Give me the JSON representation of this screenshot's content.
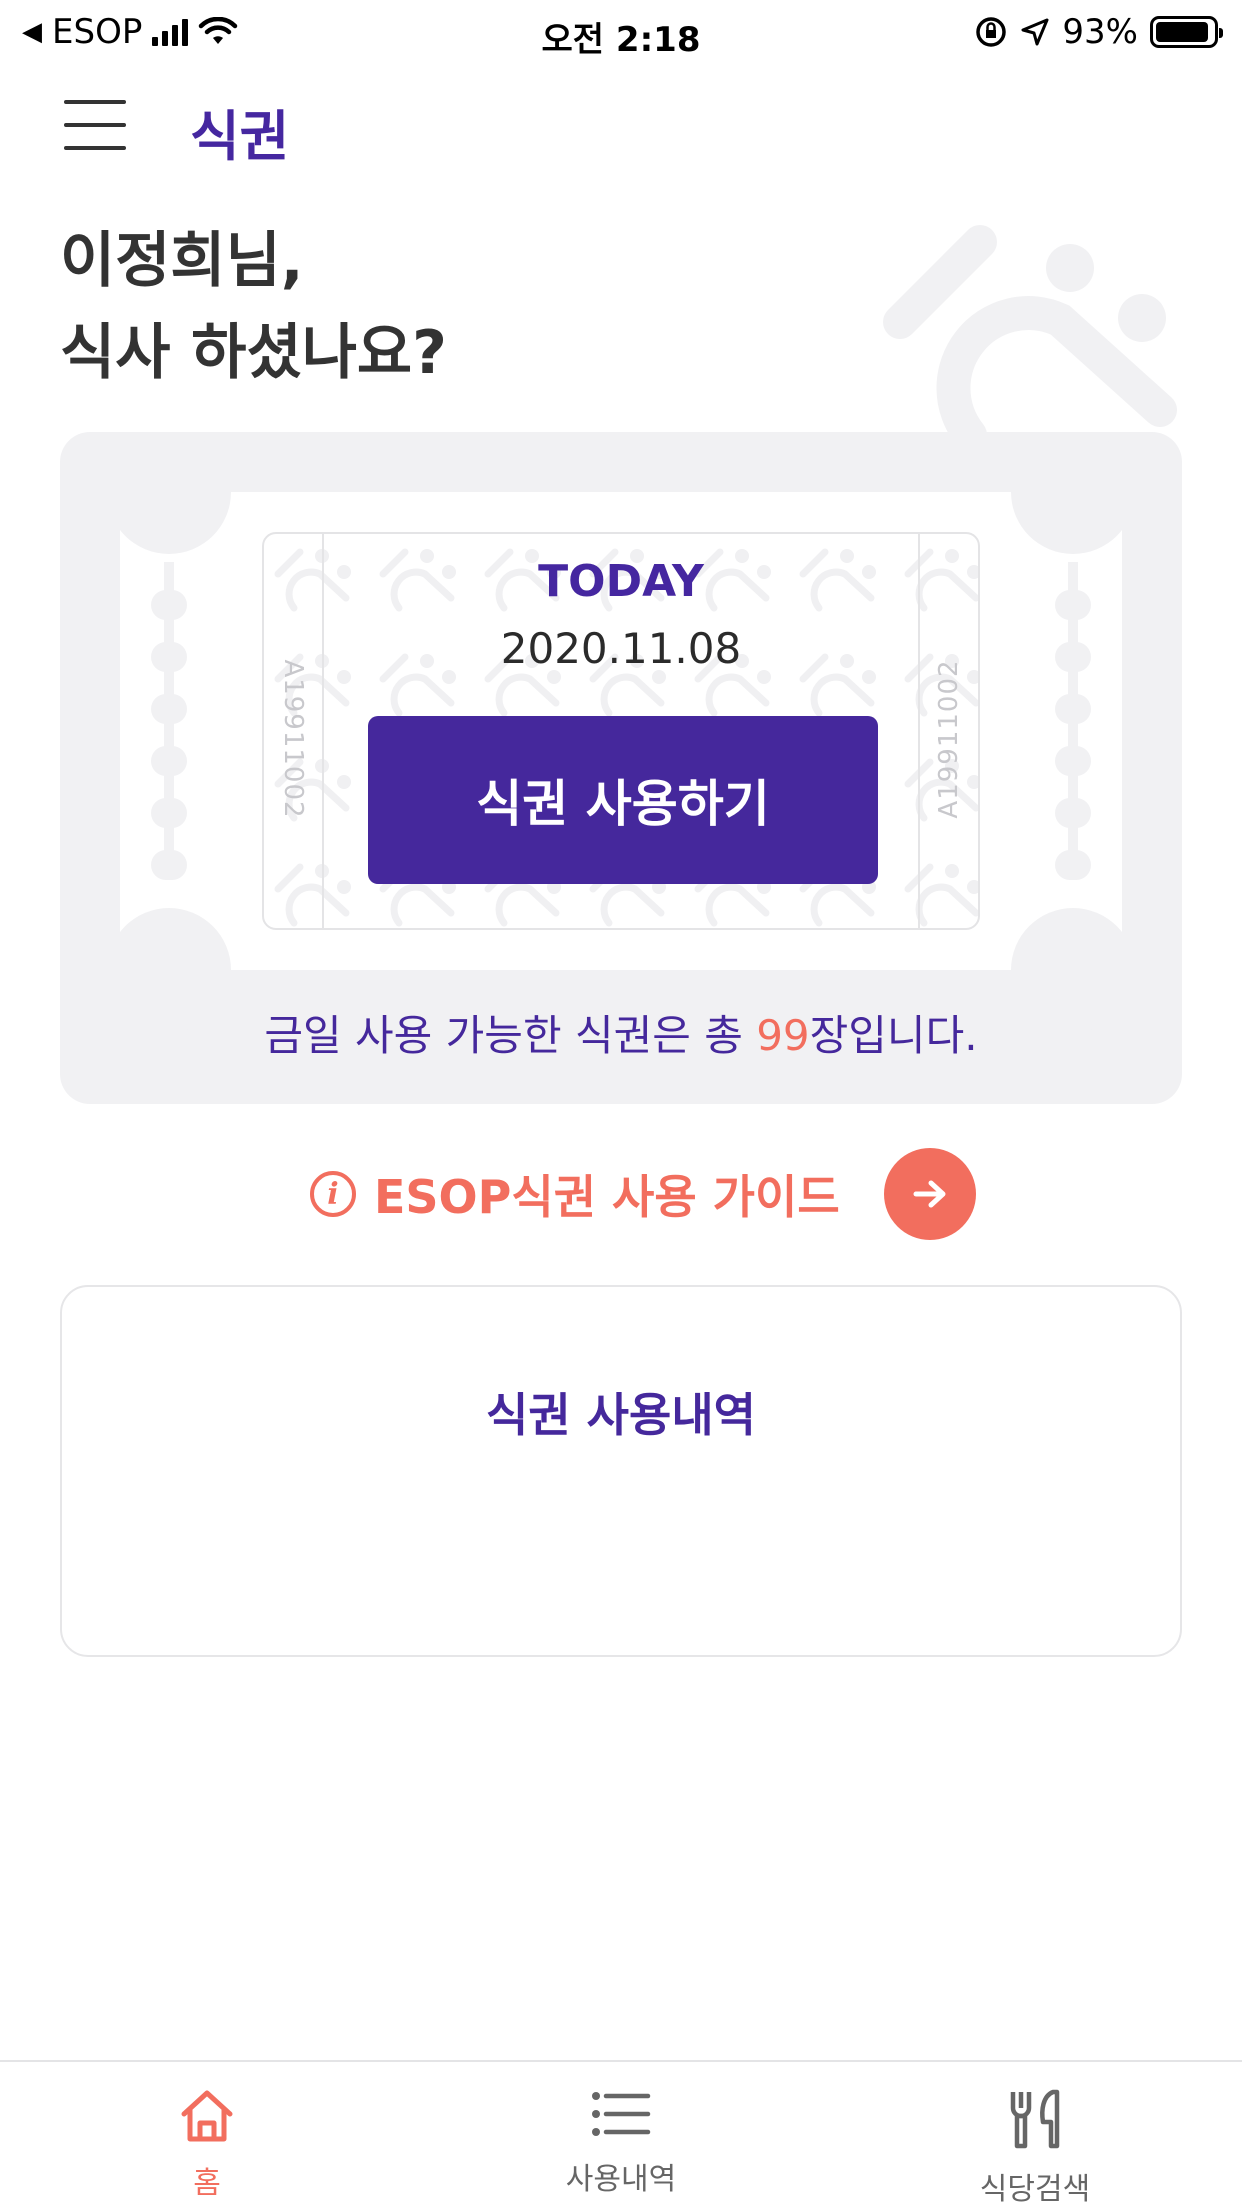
{
  "status_bar": {
    "back_app": "ESOP",
    "time": "오전 2:18",
    "battery": "93%"
  },
  "header": {
    "title": "식권",
    "menu_icon": "hamburger-icon"
  },
  "greeting": {
    "line1": "이정희님,",
    "line2": "식사 하셨나요?"
  },
  "ticket": {
    "today_label": "TODAY",
    "date": "2020.11.08",
    "use_button_label": "식권 사용하기",
    "serial_left": "A19911002",
    "serial_right": "A19911002",
    "available_prefix": "금일 사용 가능한 식권은 총 ",
    "available_count": "99",
    "available_suffix": "장입니다."
  },
  "guide": {
    "label": "ESOP식권 사용 가이드",
    "info_icon": "info-icon",
    "arrow_icon": "arrow-right-icon"
  },
  "history": {
    "title": "식권 사용내역"
  },
  "tabbar": {
    "tabs": [
      {
        "label": "홈",
        "icon": "home-icon",
        "active": true
      },
      {
        "label": "사용내역",
        "icon": "list-icon",
        "active": false
      },
      {
        "label": "식당검색",
        "icon": "fork-knife-icon",
        "active": false
      }
    ]
  },
  "colors": {
    "primary": "#45289c",
    "accent": "#f26e5e",
    "card_bg": "#f1f1f3"
  }
}
